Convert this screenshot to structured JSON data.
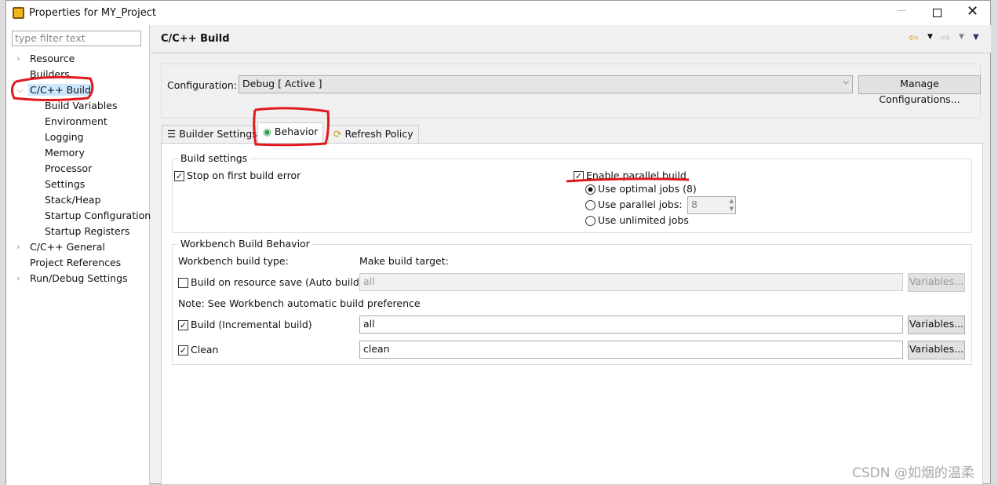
{
  "window": {
    "title": "Properties for MY_Project"
  },
  "sidebar": {
    "filter_placeholder": "type filter text",
    "items": [
      {
        "label": "Resource",
        "expandable": true
      },
      {
        "label": "Builders"
      },
      {
        "label": "C/C++ Build",
        "expanded": true,
        "selected": true
      },
      {
        "label": "Build Variables"
      },
      {
        "label": "Environment"
      },
      {
        "label": "Logging"
      },
      {
        "label": "Memory"
      },
      {
        "label": "Processor"
      },
      {
        "label": "Settings"
      },
      {
        "label": "Stack/Heap"
      },
      {
        "label": "Startup Configuration"
      },
      {
        "label": "Startup Registers"
      },
      {
        "label": "C/C++ General",
        "expandable": true
      },
      {
        "label": "Project References"
      },
      {
        "label": "Run/Debug Settings",
        "expandable": true
      }
    ]
  },
  "page": {
    "title": "C/C++ Build",
    "config_label": "Configuration:",
    "config_value": "Debug  [ Active ]",
    "manage_button": "Manage Configurations...",
    "tabs": [
      {
        "label": "Builder Settings"
      },
      {
        "label": "Behavior",
        "active": true
      },
      {
        "label": "Refresh Policy"
      }
    ]
  },
  "build_settings": {
    "title": "Build settings",
    "stop_on_error": "Stop on first build error",
    "stop_checked": true,
    "parallel": "Enable parallel build",
    "parallel_checked": true,
    "optimal": "Use optimal jobs (8)",
    "parallel_jobs": "Use parallel jobs:",
    "jobs_value": "8",
    "unlimited": "Use unlimited jobs",
    "selected_option": "optimal"
  },
  "workbench": {
    "title": "Workbench Build Behavior",
    "type_label": "Workbench build type:",
    "target_label": "Make build target:",
    "auto_label": "Build on resource save (Auto build)",
    "auto_checked": false,
    "auto_value": "all",
    "note": "Note: See Workbench automatic build preference",
    "inc_label": "Build (Incremental build)",
    "inc_checked": true,
    "inc_value": "all",
    "clean_label": "Clean",
    "clean_checked": true,
    "clean_value": "clean",
    "variables": "Variables..."
  },
  "watermark": "CSDN @如烟的温柔",
  "annotation_color": "#e0191f"
}
